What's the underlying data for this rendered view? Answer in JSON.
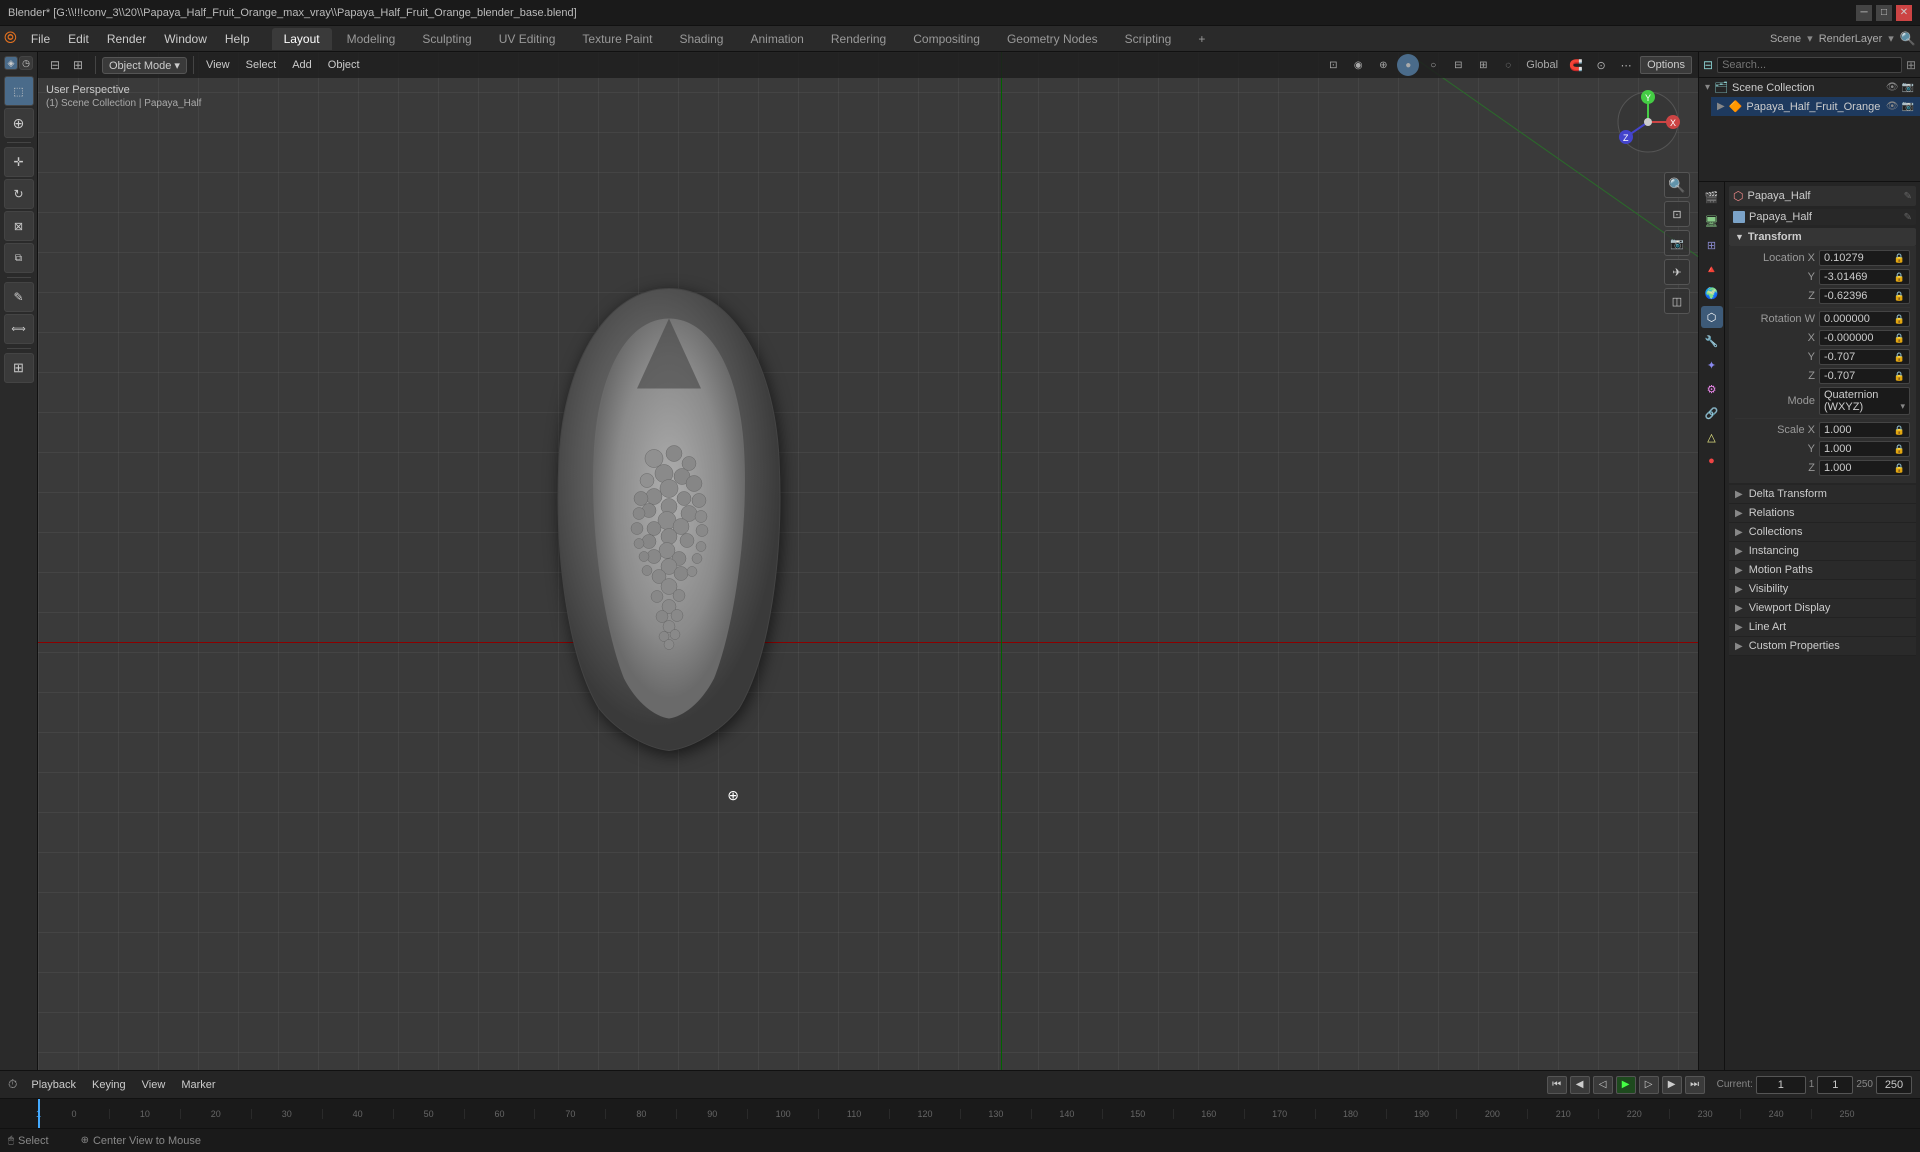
{
  "window": {
    "title": "Blender* [G:\\\\!!!conv_3\\\\20\\\\Papaya_Half_Fruit_Orange_max_vray\\\\Papaya_Half_Fruit_Orange_blender_base.blend]"
  },
  "menubar": {
    "items": [
      "Blender",
      "File",
      "Edit",
      "Render",
      "Window",
      "Help"
    ]
  },
  "workspaces": {
    "tabs": [
      "Layout",
      "Modeling",
      "Sculpting",
      "UV Editing",
      "Texture Paint",
      "Shading",
      "Animation",
      "Rendering",
      "Compositing",
      "Geometry Nodes",
      "Scripting",
      "+"
    ],
    "active": "Layout"
  },
  "viewport": {
    "mode_label": "Object Mode",
    "view_label": "View",
    "select_label": "Select",
    "add_label": "Add",
    "object_label": "Object",
    "perspective_label": "User Perspective",
    "collection_label": "(1) Scene Collection | Papaya_Half",
    "global_label": "Global",
    "options_label": "Options"
  },
  "toolbar": {
    "tools": [
      {
        "name": "select-tool",
        "icon": "⬚",
        "active": true
      },
      {
        "name": "cursor-tool",
        "icon": "✛"
      },
      {
        "name": "move-tool",
        "icon": "⊕"
      },
      {
        "name": "rotate-tool",
        "icon": "↻"
      },
      {
        "name": "scale-tool",
        "icon": "⊠"
      },
      {
        "name": "transform-tool",
        "icon": "⧉"
      },
      {
        "name": "annotate-tool",
        "icon": "✎"
      },
      {
        "name": "measure-tool",
        "icon": "📏"
      },
      {
        "name": "add-tool",
        "icon": "⊞"
      }
    ]
  },
  "outliner": {
    "title": "Scene Collection",
    "items": [
      {
        "name": "Scene Collection",
        "icon": "📁",
        "level": 0,
        "expanded": true
      },
      {
        "name": "Papaya_Half_Fruit_Orange",
        "icon": "🔶",
        "level": 1,
        "expanded": false,
        "selected": true
      }
    ],
    "search_placeholder": "Search..."
  },
  "properties": {
    "active_tab": "object",
    "object_name": "Papaya_Half",
    "mesh_name": "Papaya_Half",
    "tabs": [
      "render",
      "output",
      "view-layer",
      "scene",
      "world",
      "object",
      "modifier",
      "particles",
      "physics",
      "constraints",
      "data",
      "material"
    ],
    "transform": {
      "label": "Transform",
      "location_x": "0.10279",
      "location_y": "-3.01469",
      "location_z": "-0.62396",
      "rotation_w": "0.000000",
      "rotation_x": "-0.000000",
      "rotation_y": "-0.707",
      "rotation_z": "-0.707",
      "rotation_mode": "Quaternion (WXYZ)",
      "scale_x": "1.000",
      "scale_y": "1.000",
      "scale_z": "1.000"
    },
    "sections": [
      {
        "label": "Delta Transform",
        "expanded": false
      },
      {
        "label": "Relations",
        "expanded": false
      },
      {
        "label": "Collections",
        "expanded": false
      },
      {
        "label": "Instancing",
        "expanded": false
      },
      {
        "label": "Motion Paths",
        "expanded": false
      },
      {
        "label": "Visibility",
        "expanded": false
      },
      {
        "label": "Viewport Display",
        "expanded": false
      },
      {
        "label": "Line Art",
        "expanded": false
      },
      {
        "label": "Custom Properties",
        "expanded": false
      }
    ]
  },
  "timeline": {
    "playback_label": "Playback",
    "keying_label": "Keying",
    "view_label": "View",
    "marker_label": "Marker",
    "current_frame": "1",
    "start_frame": "1",
    "end_frame": "250",
    "frame_ticks": [
      "0",
      "10",
      "20",
      "30",
      "40",
      "50",
      "60",
      "70",
      "80",
      "90",
      "100",
      "110",
      "120",
      "130",
      "140",
      "150",
      "160",
      "170",
      "180",
      "190",
      "200",
      "210",
      "220",
      "230",
      "240",
      "250"
    ]
  },
  "statusbar": {
    "select_label": "Select",
    "center_view_label": "Center View to Mouse"
  },
  "nav_gizmo": {
    "x_label": "X",
    "y_label": "Y",
    "z_label": "Z"
  }
}
